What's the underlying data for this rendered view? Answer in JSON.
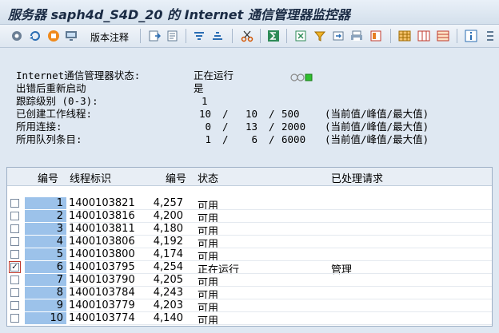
{
  "window": {
    "title": "服务器 saph4d_S4D_20 的 Internet 通信管理器监控器"
  },
  "toolbar": {
    "version_notes_label": "版本注释"
  },
  "info": {
    "rows": [
      {
        "label": "Internet通信管理器状态:",
        "value": "正在运行"
      },
      {
        "label": "出错后重新启动",
        "value": "是"
      },
      {
        "label": "跟踪级别 (0-3):",
        "value": "1"
      },
      {
        "label": "已创建工作线程:",
        "current": "10",
        "peak": "10",
        "max": "500",
        "note": "(当前值/峰值/最大值)"
      },
      {
        "label": "所用连接:",
        "current": "0",
        "peak": "13",
        "max": "2000",
        "note": "(当前值/峰值/最大值)"
      },
      {
        "label": "所用队列条目:",
        "current": "1",
        "peak": "6",
        "max": "6000",
        "note": "(当前值/峰值/最大值)"
      }
    ],
    "sep": "/",
    "status_color": "#2fbf2f"
  },
  "table": {
    "headers": [
      "编号",
      "线程标识",
      "编号",
      "状态",
      "已处理请求"
    ],
    "rows": [
      {
        "no": "1",
        "thread": "1400103821",
        "num": "4,257",
        "status": "可用",
        "request": "",
        "checked": false
      },
      {
        "no": "2",
        "thread": "1400103816",
        "num": "4,200",
        "status": "可用",
        "request": "",
        "checked": false
      },
      {
        "no": "3",
        "thread": "1400103811",
        "num": "4,180",
        "status": "可用",
        "request": "",
        "checked": false
      },
      {
        "no": "4",
        "thread": "1400103806",
        "num": "4,192",
        "status": "可用",
        "request": "",
        "checked": false
      },
      {
        "no": "5",
        "thread": "1400103800",
        "num": "4,174",
        "status": "可用",
        "request": "",
        "checked": false
      },
      {
        "no": "6",
        "thread": "1400103795",
        "num": "4,254",
        "status": "正在运行",
        "request": "管理",
        "checked": true
      },
      {
        "no": "7",
        "thread": "1400103790",
        "num": "4,205",
        "status": "可用",
        "request": "",
        "checked": false
      },
      {
        "no": "8",
        "thread": "1400103784",
        "num": "4,243",
        "status": "可用",
        "request": "",
        "checked": false
      },
      {
        "no": "9",
        "thread": "1400103779",
        "num": "4,203",
        "status": "可用",
        "request": "",
        "checked": false
      },
      {
        "no": "10",
        "thread": "1400103774",
        "num": "4,140",
        "status": "可用",
        "request": "",
        "checked": false
      }
    ]
  }
}
